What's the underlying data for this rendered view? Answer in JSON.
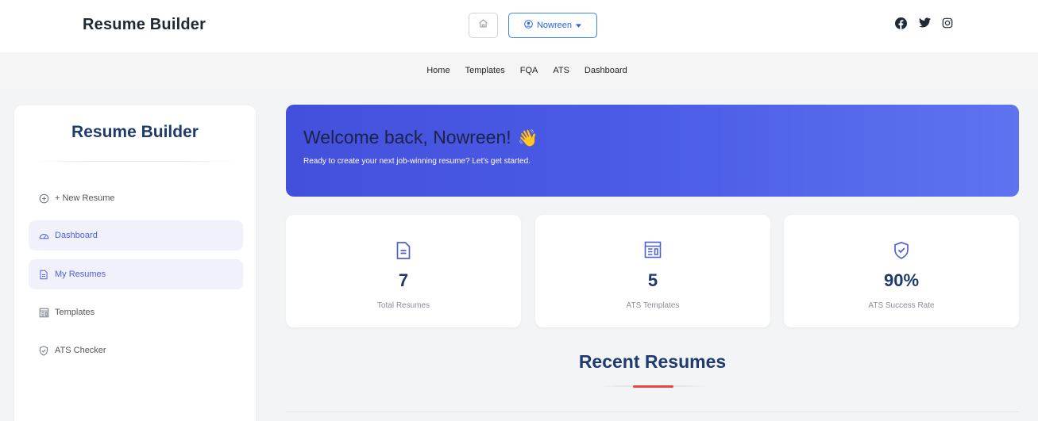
{
  "header": {
    "brand": "Resume Builder",
    "user_menu_label": "Nowreen",
    "icons": {
      "home": "home-icon",
      "user": "user-circle-icon",
      "caret": "caret-down-icon",
      "facebook": "facebook-icon",
      "twitter": "twitter-icon",
      "instagram": "instagram-icon"
    }
  },
  "nav": {
    "items": [
      "Home",
      "Templates",
      "FQA",
      "ATS",
      "Dashboard"
    ]
  },
  "sidebar": {
    "title": "Resume Builder",
    "items": [
      {
        "label": "+ New Resume",
        "icon": "plus-circle-icon",
        "active": false
      },
      {
        "label": "Dashboard",
        "icon": "dashboard-icon",
        "active": true
      },
      {
        "label": "My Resumes",
        "icon": "document-icon",
        "active": true
      },
      {
        "label": "Templates",
        "icon": "template-icon",
        "active": false
      },
      {
        "label": "ATS Checker",
        "icon": "shield-check-icon",
        "active": false
      }
    ]
  },
  "welcome": {
    "title": "Welcome back, Nowreen!",
    "emoji": "👋",
    "subtitle": "Ready to create your next job-winning resume? Let's get started."
  },
  "stats": [
    {
      "value": "7",
      "label": "Total Resumes",
      "icon": "document-icon"
    },
    {
      "value": "5",
      "label": "ATS Templates",
      "icon": "template-icon"
    },
    {
      "value": "90%",
      "label": "ATS Success Rate",
      "icon": "shield-check-icon"
    }
  ],
  "recent": {
    "title": "Recent Resumes"
  },
  "colors": {
    "primary": "#4f5fd9",
    "heading": "#1e3a6e",
    "accent": "#ef4444",
    "banner_start": "#4350dc",
    "banner_end": "#5e73f0"
  }
}
